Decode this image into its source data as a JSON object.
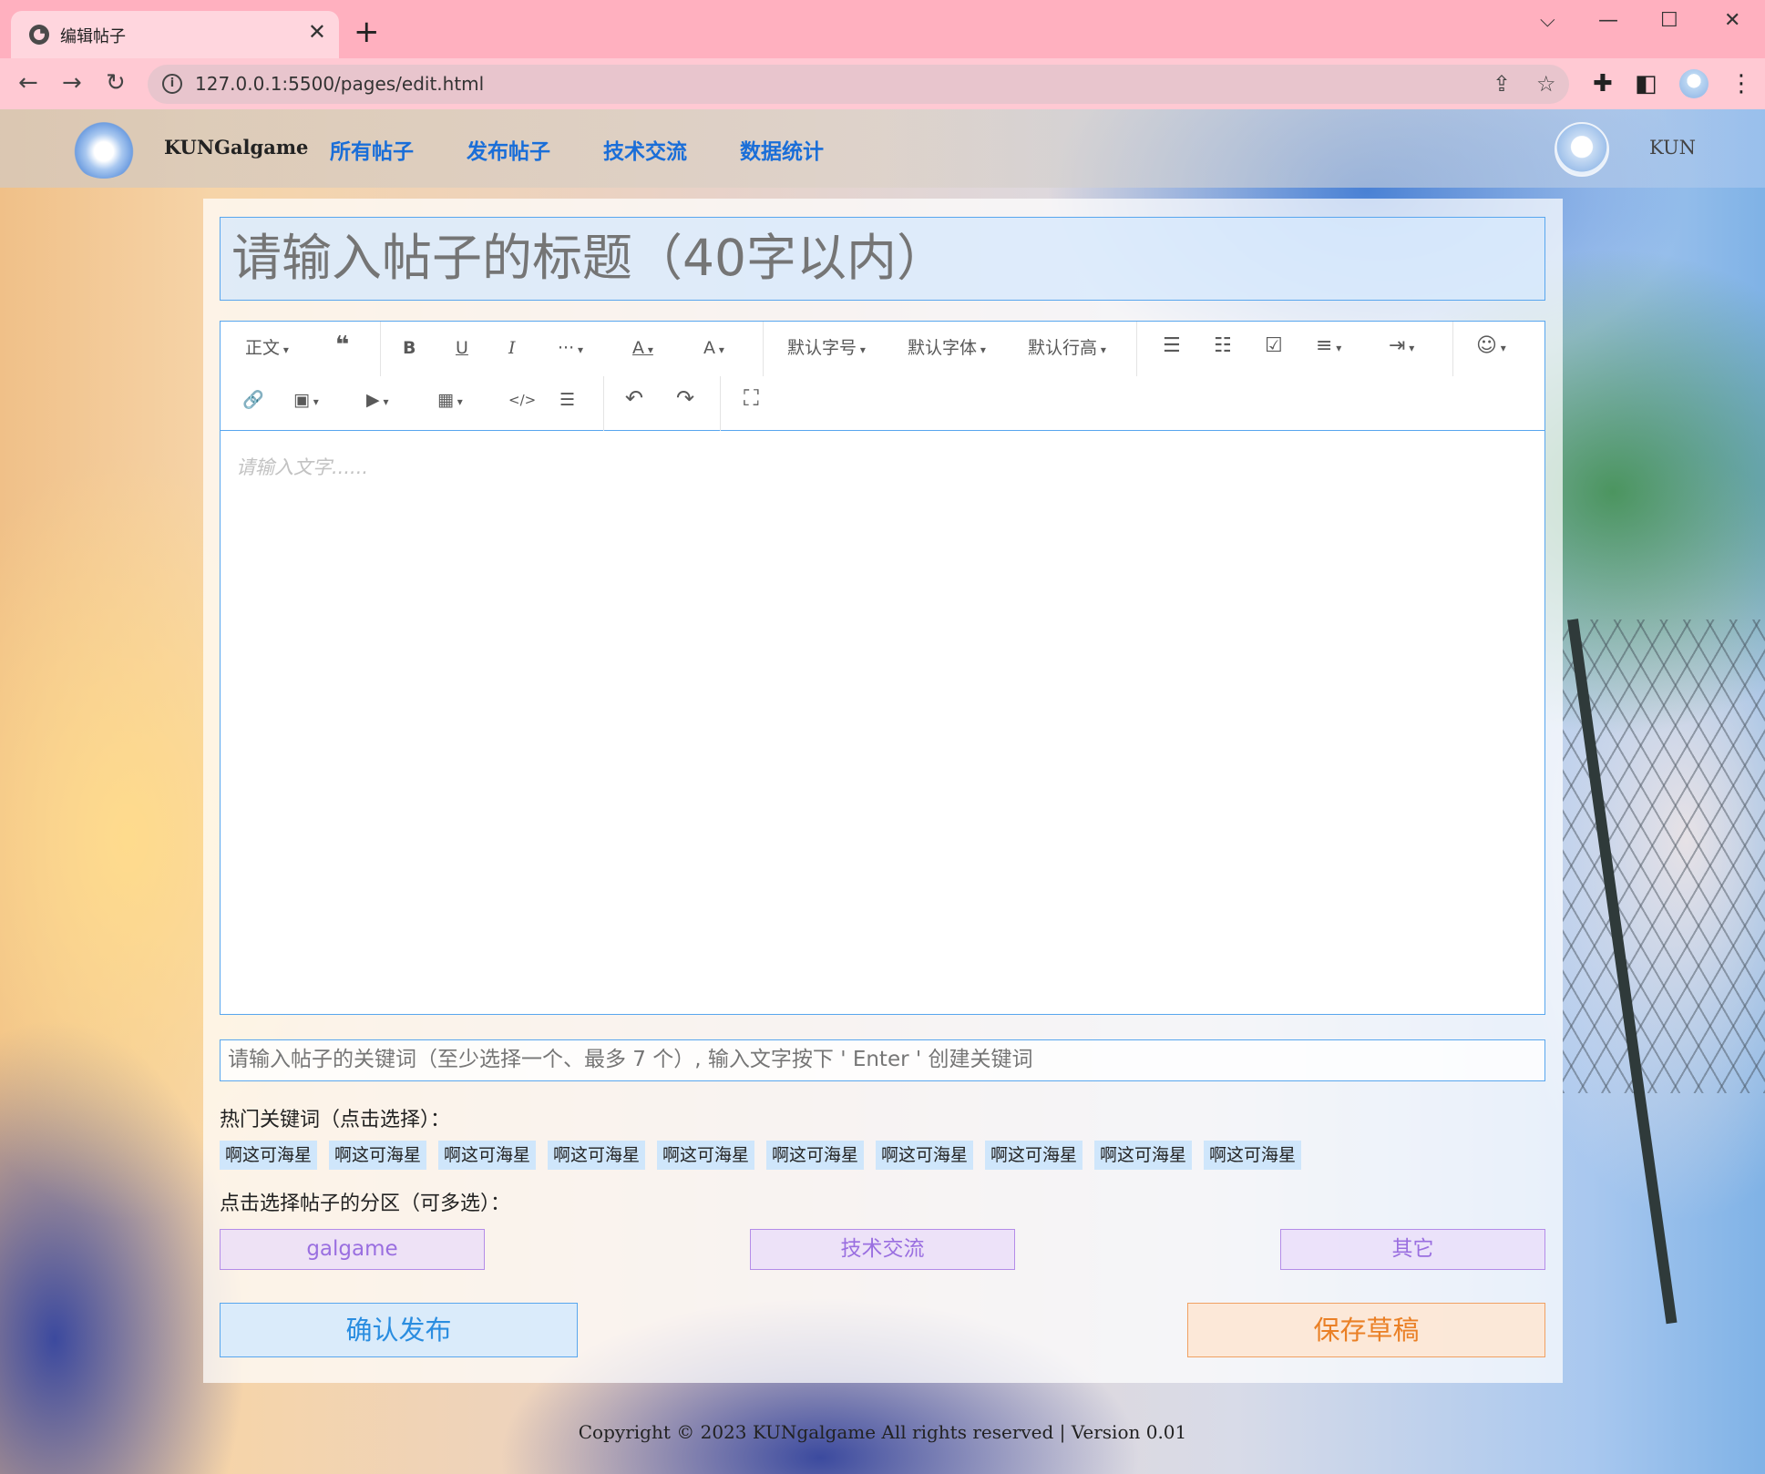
{
  "browser": {
    "tab_title": "编辑帖子",
    "tab_close": "✕",
    "new_tab": "+",
    "url": "127.0.0.1:5500/pages/edit.html",
    "window_controls": {
      "dropdown": "⌵",
      "minimize": "—",
      "maximize": "☐",
      "close": "✕"
    },
    "nav": {
      "back": "←",
      "forward": "→",
      "reload": "↻"
    },
    "icons": [
      "share-icon",
      "star-icon",
      "puzzle-icon",
      "sidebar-icon",
      "profile-avatar",
      "kebab-menu-icon"
    ]
  },
  "site": {
    "brand": "KUNGalgame",
    "nav": [
      "所有帖子",
      "发布帖子",
      "技术交流",
      "数据统计"
    ],
    "username": "KUN"
  },
  "editor": {
    "title_placeholder": "请输入帖子的标题（40字以内）",
    "toolbar_row1": [
      "正文",
      "❝",
      "B",
      "U",
      "I",
      "···",
      "A",
      "A",
      "默认字号",
      "默认字体",
      "默认行高",
      "☰",
      "☷",
      "☑",
      "≡",
      "⇥",
      "☺"
    ],
    "toolbar_row2": [
      "🔗",
      "▣",
      "▶",
      "▦",
      "</>",
      "☰",
      "↶",
      "↷",
      "⛶"
    ],
    "body_placeholder": "请输入文字......"
  },
  "keywords": {
    "input_placeholder": "请输入帖子的关键词（至少选择一个、最多 7 个）, 输入文字按下 ' Enter ' 创建关键词",
    "hot_label": "热门关键词（点击选择）：",
    "hot_tags": [
      "啊这可海星",
      "啊这可海星",
      "啊这可海星",
      "啊这可海星",
      "啊这可海星",
      "啊这可海星",
      "啊这可海星",
      "啊这可海星",
      "啊这可海星",
      "啊这可海星"
    ]
  },
  "sections": {
    "label": "点击选择帖子的分区（可多选）：",
    "options": [
      "galgame",
      "技术交流",
      "其它"
    ]
  },
  "actions": {
    "publish": "确认发布",
    "save_draft": "保存草稿"
  },
  "footer": "Copyright © 2023 KUNgalgame All rights reserved | Version 0.01",
  "colors": {
    "accent_blue": "#1a6ed8",
    "border_blue": "#58a6ee",
    "section_purple": "#9a6fe0",
    "draft_orange": "#ea8026",
    "chrome_pink": "#ffb0bf"
  }
}
